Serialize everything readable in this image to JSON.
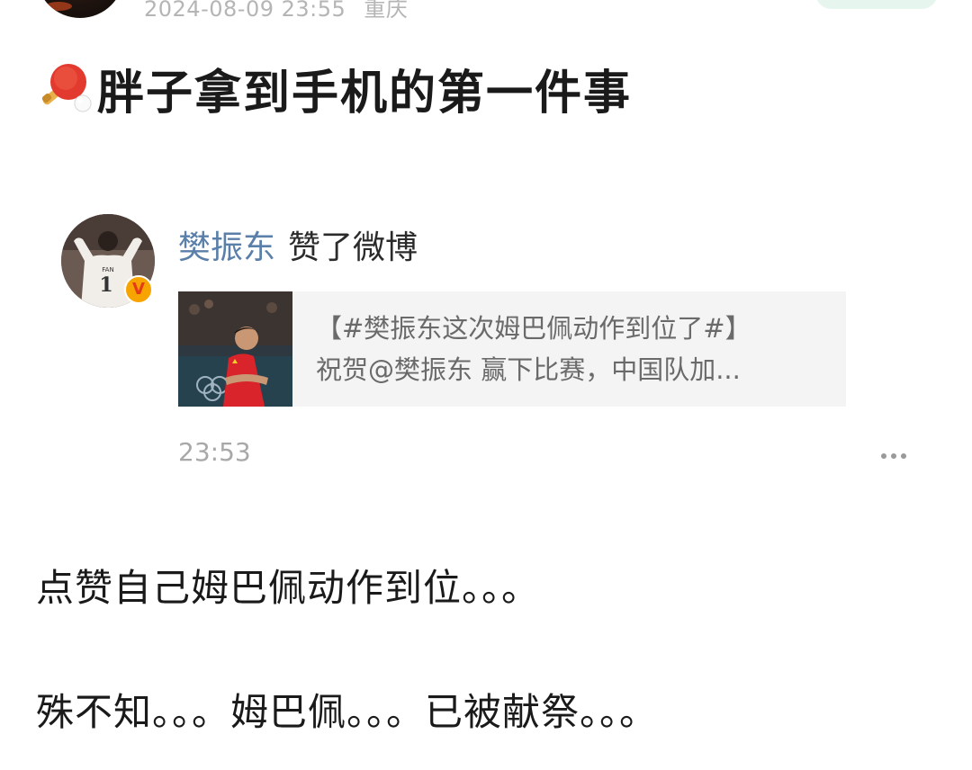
{
  "post": {
    "datetime": "2024-08-09 23:55",
    "location": "重庆",
    "title": "胖子拿到手机的第一件事",
    "title_icon": "ping-pong-paddle-icon"
  },
  "embedded_card": {
    "username": "樊振东",
    "action": "赞了微博",
    "avatar_jersey_name": "FAN",
    "avatar_jersey_number": "1",
    "verified_badge": "V",
    "quote": {
      "line1": "【#樊振东这次姆巴佩动作到位了#】",
      "line2": "祝贺@樊振东 赢下比赛，中国队加..."
    },
    "time": "23:53",
    "more_icon": "more-horizontal-icon"
  },
  "body": {
    "line1": "点赞自己姆巴佩动作到位。。。",
    "line2": "殊不知。。。姆巴佩。。。已被献祭。。。"
  },
  "colors": {
    "username": "#5a7fa8",
    "meta_gray": "#b5b5b5",
    "quote_bg": "#f4f4f4",
    "follow_pill": "#e6f6ee"
  }
}
